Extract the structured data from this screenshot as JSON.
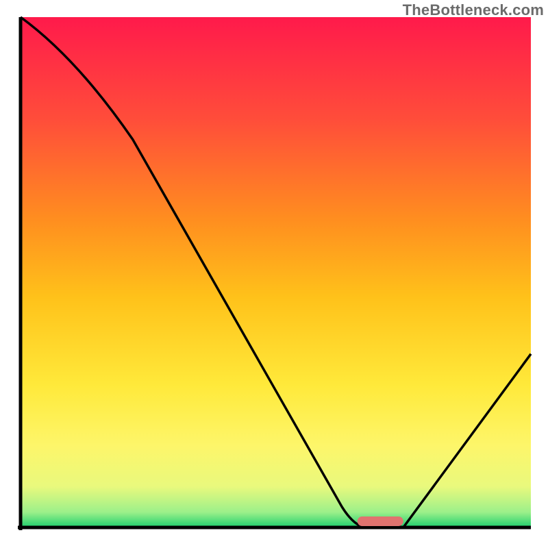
{
  "watermark": "TheBottleneck.com",
  "chart_data": {
    "type": "line",
    "title": "",
    "xlabel": "",
    "ylabel": "",
    "xlim": [
      0,
      100
    ],
    "ylim": [
      0,
      100
    ],
    "x": [
      0,
      22,
      63,
      68,
      75,
      100
    ],
    "values": [
      100,
      76,
      4,
      0,
      0,
      34
    ],
    "marker": {
      "x_start": 66,
      "x_end": 75,
      "y": 0
    },
    "gradient_stops": [
      {
        "offset": 0.0,
        "color": "#ff1a4b"
      },
      {
        "offset": 0.2,
        "color": "#ff4d3a"
      },
      {
        "offset": 0.4,
        "color": "#ff8f1f"
      },
      {
        "offset": 0.55,
        "color": "#ffc21a"
      },
      {
        "offset": 0.72,
        "color": "#ffe93a"
      },
      {
        "offset": 0.84,
        "color": "#fdf66a"
      },
      {
        "offset": 0.92,
        "color": "#e9f97d"
      },
      {
        "offset": 0.97,
        "color": "#9cf08a"
      },
      {
        "offset": 1.0,
        "color": "#1ecf6e"
      }
    ],
    "axis_color": "#000000",
    "curve_color": "#000000",
    "marker_color": "#e0736f"
  }
}
